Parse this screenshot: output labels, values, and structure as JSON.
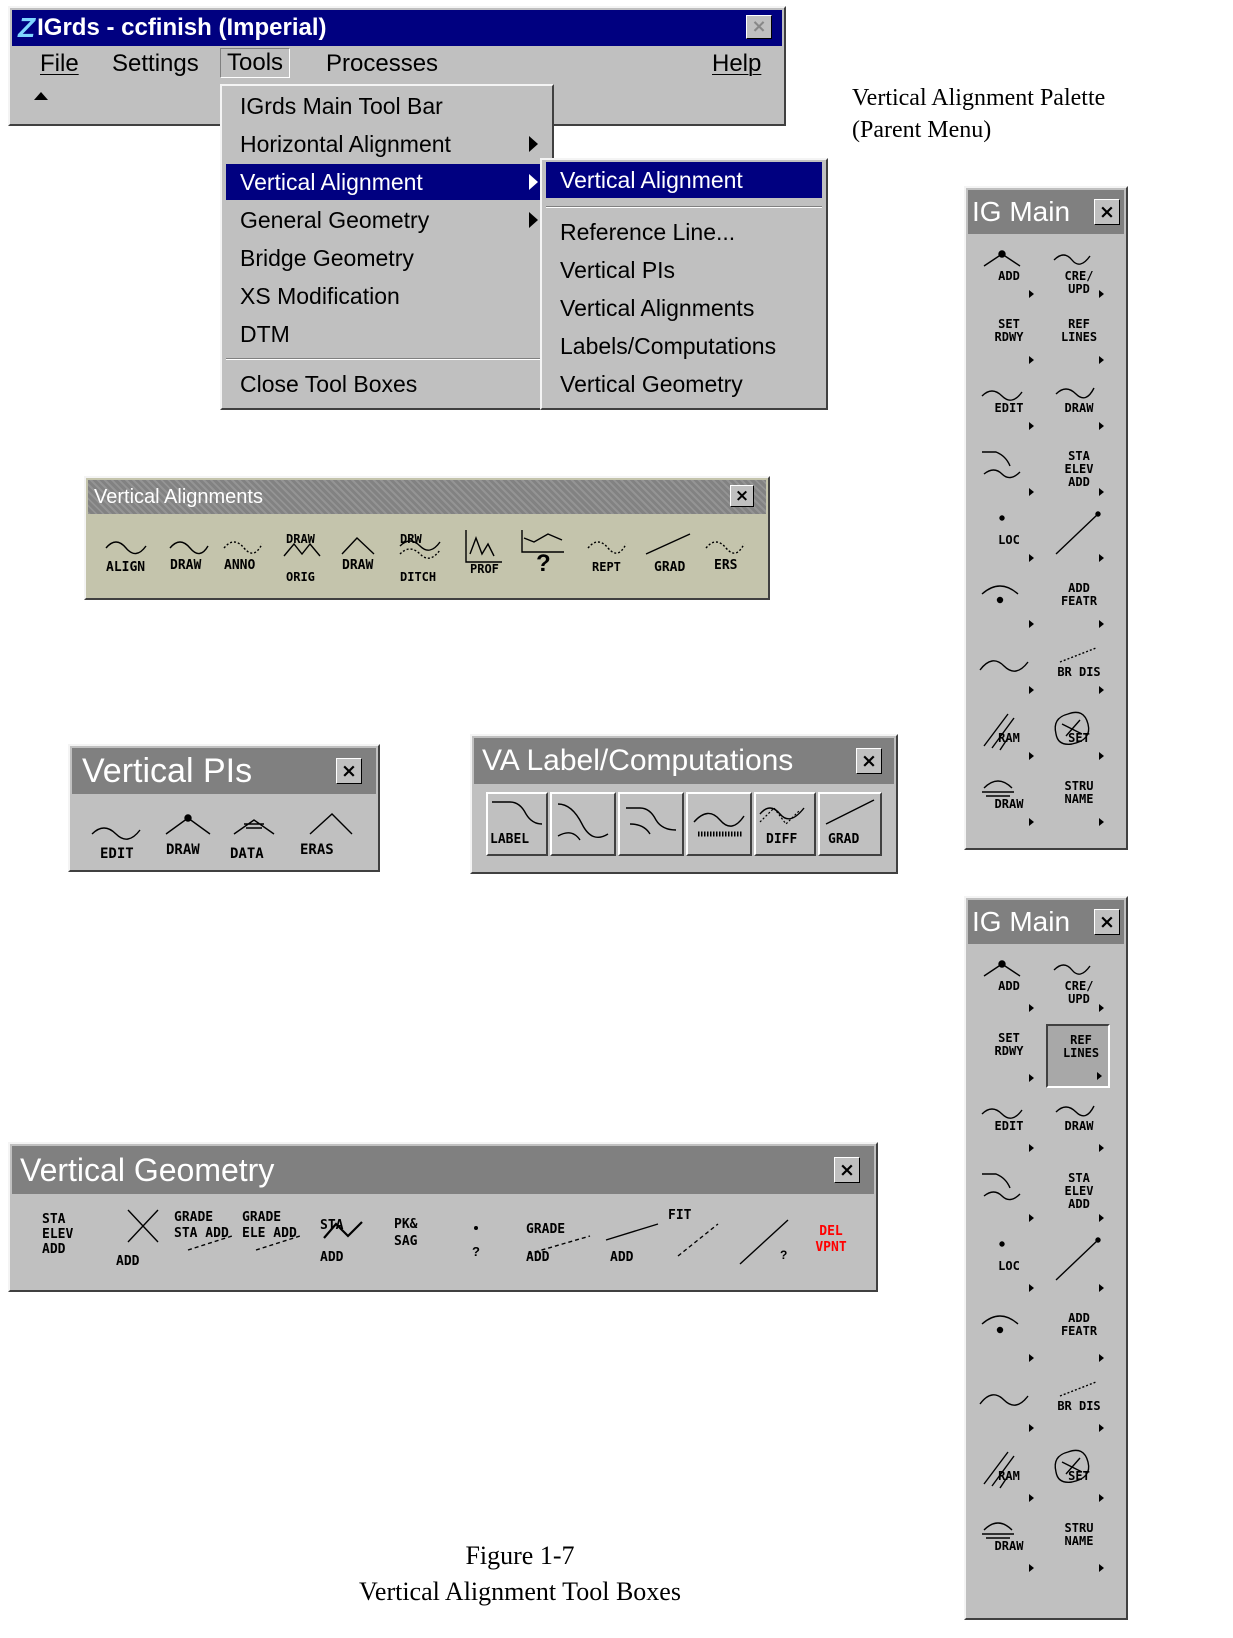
{
  "main_window": {
    "title": "IGrds - ccfinish (Imperial)",
    "menus": [
      "File",
      "Settings",
      "Tools",
      "Processes",
      "Help"
    ],
    "tools_menu": [
      "IGrds Main Tool Bar",
      "Horizontal Alignment",
      "Vertical Alignment",
      "General Geometry",
      "Bridge Geometry",
      "XS Modification",
      "DTM",
      "Close Tool Boxes"
    ],
    "submenu": [
      "Vertical Alignment",
      "Reference Line...",
      "Vertical PIs",
      "Vertical Alignments",
      "Labels/Computations",
      "Vertical Geometry"
    ]
  },
  "palette_caption": {
    "line1": "Vertical Alignment Palette",
    "line2": "(Parent Menu)"
  },
  "va_toolbox": {
    "title": "Vertical Alignments",
    "buttons": [
      "ALIGN",
      "DRAW",
      "ANNO",
      "DRAW ORIG",
      "DRAW",
      "DRW DITCH",
      "PROF",
      "?",
      "REPT",
      "GRAD",
      "ERS"
    ]
  },
  "vpi_toolbox": {
    "title": "Vertical PIs",
    "buttons": [
      "EDIT",
      "DRAW",
      "DATA",
      "ERAS"
    ]
  },
  "label_toolbox": {
    "title": "VA Label/Computations",
    "buttons": [
      "LABEL",
      "",
      "",
      "",
      "DIFF",
      "GRAD"
    ]
  },
  "vg_toolbox": {
    "title": "Vertical Geometry",
    "buttons": [
      "STA ELEV ADD",
      "ADD",
      "GRADE STA ADD",
      "GRADE ELE ADD",
      "STA ADD",
      "PK& SAG",
      "?",
      "GRADE ADD",
      "ADD",
      "FIT",
      "?",
      "DEL VPNT"
    ],
    "del_color": "#ff0000"
  },
  "ig_main": {
    "title": "IG Main",
    "buttons": [
      "ADD",
      "CRE/ UPD",
      "SET RDWY",
      "REF LINES",
      "EDIT",
      "DRAW",
      "",
      "STA ELEV ADD",
      "LOC",
      "",
      "",
      "ADD FEATR",
      "",
      "BR DIS",
      "RAM",
      "SET",
      "DRAW",
      "STRU NAME"
    ]
  },
  "figure_caption": {
    "line1": "Figure 1-7",
    "line2": "Vertical Alignment Tool Boxes"
  }
}
